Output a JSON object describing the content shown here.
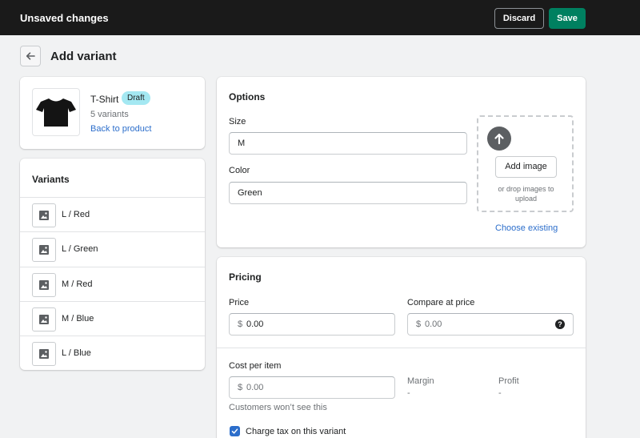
{
  "topbar": {
    "title": "Unsaved changes",
    "discard_label": "Discard",
    "save_label": "Save"
  },
  "page": {
    "title": "Add variant",
    "back_icon": "arrow-left-icon"
  },
  "product": {
    "name": "T-Shirt",
    "status": "Draft",
    "variant_count": "5 variants",
    "back_link": "Back to product",
    "image_icon": "tshirt-icon"
  },
  "variants": {
    "header": "Variants",
    "items": [
      {
        "label": "L / Red"
      },
      {
        "label": "L / Green"
      },
      {
        "label": "M / Red"
      },
      {
        "label": "M / Blue"
      },
      {
        "label": "L / Blue"
      }
    ]
  },
  "options": {
    "title": "Options",
    "size_label": "Size",
    "size_value": "M",
    "color_label": "Color",
    "color_value": "Green",
    "add_image_label": "Add image",
    "drop_hint": "or drop images to upload",
    "choose_existing": "Choose existing"
  },
  "pricing": {
    "title": "Pricing",
    "price_label": "Price",
    "price_currency": "$",
    "price_value": "0.00",
    "compare_label": "Compare at price",
    "compare_currency": "$",
    "compare_value": "0.00",
    "cost_label": "Cost per item",
    "cost_currency": "$",
    "cost_value": "0.00",
    "cost_help": "Customers won’t see this",
    "margin_label": "Margin",
    "margin_value": "-",
    "profit_label": "Profit",
    "profit_value": "-",
    "charge_tax_label": "Charge tax on this variant",
    "charge_tax_checked": true
  },
  "colors": {
    "topbar_bg": "#1a1a1a",
    "primary": "#008060",
    "link": "#2c6ecb",
    "badge": "#a4e8f2"
  }
}
